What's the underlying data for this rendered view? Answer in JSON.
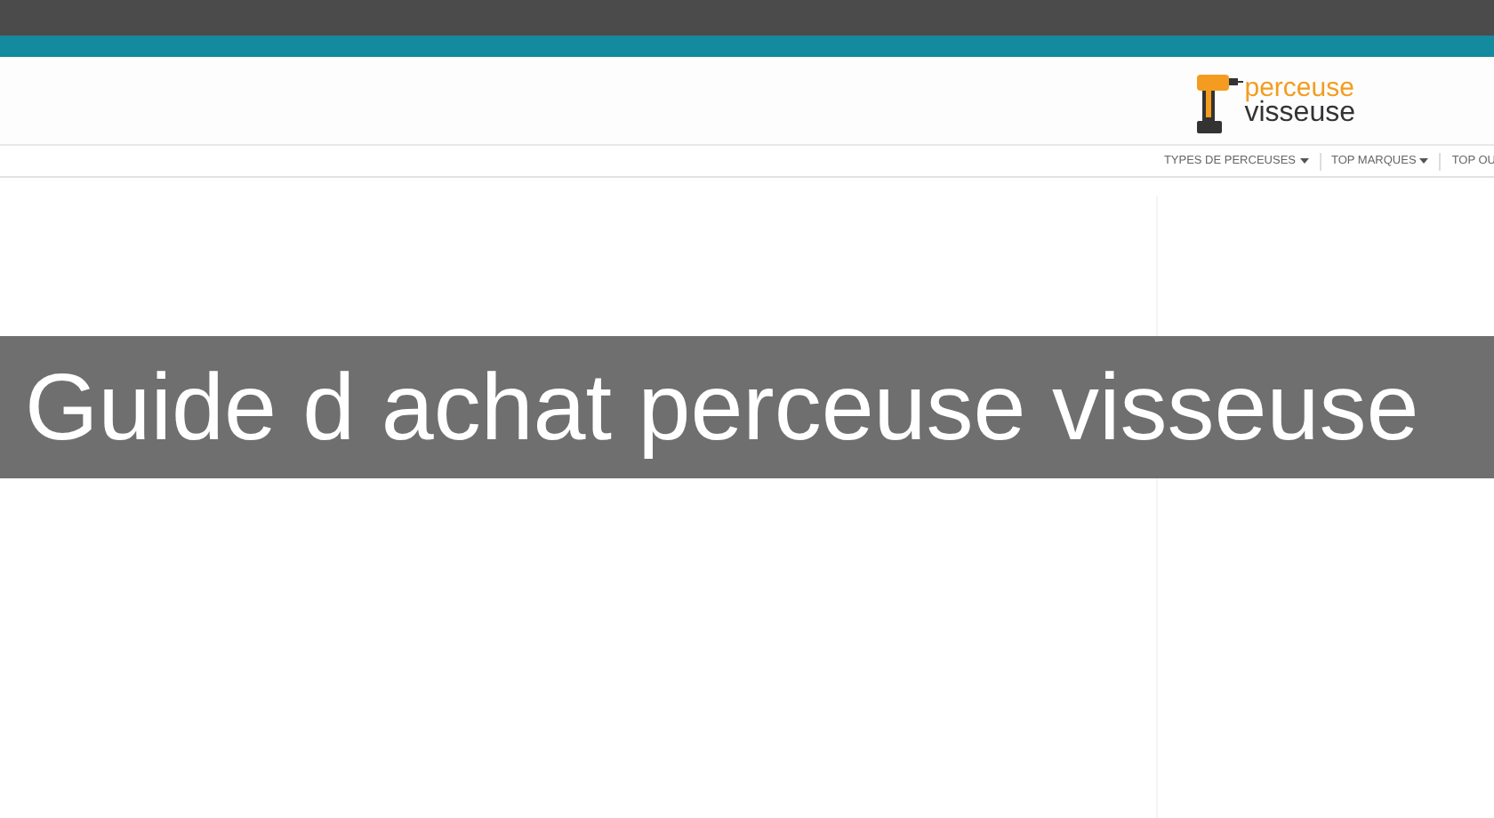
{
  "logo": {
    "line_1": "perceuse",
    "line_2": "visseuse"
  },
  "nav": [
    {
      "label": "TYPES DE PERCEUSES",
      "dropdown": true
    },
    {
      "label": "TOP MARQUES",
      "dropdown": true
    },
    {
      "label": "TOP OU",
      "dropdown": false
    }
  ],
  "banner": {
    "title": "Guide d achat perceuse visseuse"
  }
}
